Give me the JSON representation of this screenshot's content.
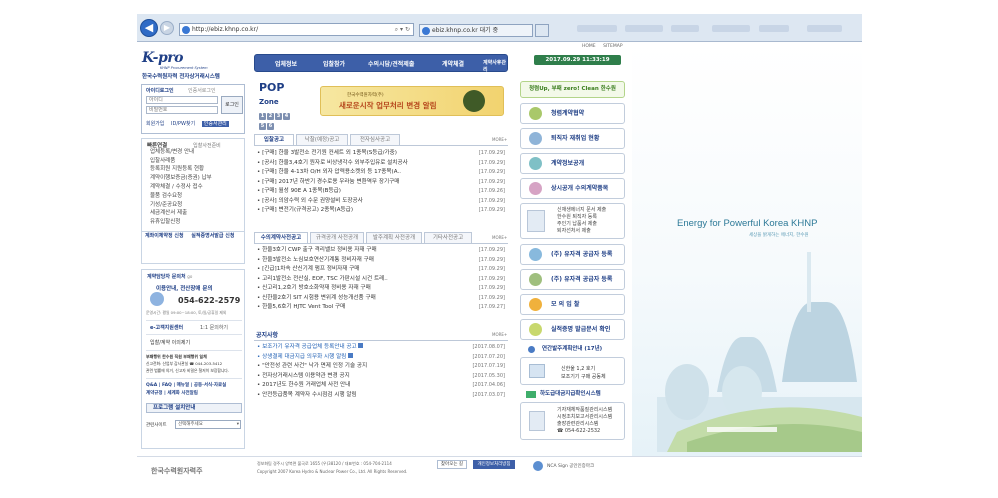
{
  "browser": {
    "url": "http://ebiz.khnp.co.kr/",
    "tabs": [
      "ebiz.khnp.co.kr 대기 중",
      ""
    ]
  },
  "header": {
    "top_links": [
      "HOME",
      "SITEMAP"
    ],
    "logo_text": "K-pro",
    "logo_sub": "KHNP Procurement System",
    "logo_name": "한국수력원자력 전자상거래시스템",
    "nav": [
      "업체정보",
      "입찰참가",
      "수의시담/견적제출",
      "계약체결",
      "계약사후관리"
    ],
    "datetime": "2017.09.29   11:33:19"
  },
  "login": {
    "tabs": [
      "아이디로그인",
      "인증서로그인"
    ],
    "id_placeholder": "아이디",
    "pw_placeholder": "비밀번호",
    "login_button": "로그인",
    "links": [
      "회원가입",
      "ID/PW찾기",
      "인증서관리"
    ]
  },
  "quick": {
    "title": "빠른연결",
    "sub": "입찰사전준비",
    "items": [
      "업체등록/변경 안내",
      "입찰사례품",
      "등록회원 지원등록 현황",
      "계약이행보증금(증권) 납부",
      "계약체결 / 수정사 접수",
      "물품 검수요청",
      "기성/준공요청",
      "세금계산서 제출",
      "유휴입찰신청"
    ],
    "banner1": "계좌이체약정 신청",
    "banner2": "실적증명서발급 신청"
  },
  "contact": {
    "title": "계약담당자 문의처",
    "title_more": "go",
    "line1": "이용안내, 전산장애 문의",
    "phone": "054-622-2579",
    "hours": "운영시간: 평일 09:00~18:00, 토/일/공휴일 제외",
    "center": "e-고객지원센터",
    "center_sub": "1:1 문의하기",
    "consult": "입찰/계약 이의제기",
    "report_title": "부패행위 한수원 직원 부패행위 일체",
    "report_lines": [
      "신고전화: 산업부 감사관실 ☎ 044-203-5412",
      "관련 법률에 의거, 신고자 비밀은 철저히 보장합니다."
    ],
    "links": [
      "Q&A",
      "FAQ",
      "매뉴얼",
      "공동·서식·자료실",
      "계약규정",
      "세계화 사전알림"
    ],
    "program": "프로그램 설치안내",
    "select_label": "관련사이트",
    "select_value": "선택해주세요"
  },
  "pop": {
    "title": "POP",
    "title_small": "Zone",
    "nums": [
      "1",
      "2",
      "3",
      "4",
      "5",
      "6"
    ],
    "banner_small": "한국수력원자력(주)",
    "banner_main": "새로운시작 업무처리 변경 알림"
  },
  "bid_notice": {
    "tabs": [
      "입찰공고",
      "낙찰(예정)공고",
      "전자심사공고"
    ],
    "more": "MORE+",
    "rows": [
      {
        "t": "[구매] 한울 3발전소 전기원 컨세트 외 1종목(S등급/가중)",
        "d": "[17.09.29]"
      },
      {
        "t": "[공사] 한울3,4호기 원자로 비상냉각수 외부주입유로 설치공사",
        "d": "[17.09.29]"
      },
      {
        "t": "[구매] 한울 4-13차 O/H 외자 압력용소켓외 등 17종목(A..",
        "d": "[17.09.29]"
      },
      {
        "t": "[구매] 2017년 하반기 경수로용 우라늄 변환역무 장기구매",
        "d": "[17.09.29]"
      },
      {
        "t": "[구매] 월성 90E A 1종목(B등급)",
        "d": "[17.09.26]"
      },
      {
        "t": "[공사] 의암수력 외 수문 권양설비 도장공사",
        "d": "[17.09.29]"
      },
      {
        "t": "[구매] 변전기(규격공고) 2종목(A등급)",
        "d": "[17.09.29]"
      }
    ]
  },
  "private": {
    "tabs": [
      "수의계약사전공고",
      "규격공개 사전공개",
      "발주계획 사전공개",
      "기타사전공고"
    ],
    "more": "MORE+",
    "rows": [
      {
        "t": "한울3호기 CWP 출구 격리밸브 정비용 자재 구매",
        "d": "[17.09.29]"
      },
      {
        "t": "한울3발전소 노심보호연산기계통 정비자재 구매",
        "d": "[17.09.29]"
      },
      {
        "t": "[긴급]1차속 산신기계 펌프 정비자재 구매",
        "d": "[17.09.29]"
      },
      {
        "t": "고리1발전소 전산실, EOF, TSC 가판시설 시건 트레..",
        "d": "[17.09.29]"
      },
      {
        "t": "신고리1,2호기 방호소화약재 정비용 자재 구매",
        "d": "[17.09.29]"
      },
      {
        "t": "신한울2호기 SIT 시험용 변위계 성능개선품 구매",
        "d": "[17.09.29]"
      },
      {
        "t": "한울5,6호기 HJTC Vent Tool 구매",
        "d": "[17.09.27]"
      }
    ]
  },
  "notice": {
    "title": "공지사항",
    "more": "MORE+",
    "rows": [
      {
        "t": "보조가기 유자격 공급업체 등록안내 공고",
        "d": "[2017.08.07]",
        "hl": true
      },
      {
        "t": "상생결제 대금지급 의무화 시행 알림",
        "d": "[2017.07.20]",
        "hl": true
      },
      {
        "t": "\"안전성 관련 사건\" 낙가 면제 인정 기술 공지",
        "d": "[2017.07.19]",
        "hl": false
      },
      {
        "t": "전자상거래시스템 이용약관 변경 공지",
        "d": "[2017.05.30]",
        "hl": false
      },
      {
        "t": "2017년도 한수원 거래업체 사전 안내",
        "d": "[2017.04.06]",
        "hl": false
      },
      {
        "t": "안전등급품목 계약자 수시점검 시행 알림",
        "d": "[2017.03.07]",
        "hl": false
      }
    ]
  },
  "right": {
    "clean_banner": "청렴Up, 부패 zero! Clean 한수원",
    "buttons": [
      "청렴계약협약",
      "퇴직자 재취업 현황",
      "계약정보공개",
      "상시공개 수의계약품목"
    ],
    "list1": [
      "신재생에너지 문서 제출",
      "한수원 퇴직자 등록",
      "주인기 납품서 제출",
      "퇴자선처서 제출"
    ],
    "buttons2": [
      "(주) 유자격 공급자 등록",
      "(주) 유자격 공급자 등록",
      "모 의 입 찰",
      "실적증명 발급문서 확인",
      "연간발주계획안내 (17년)"
    ],
    "report_line1": "신한울 1,2 호기",
    "report_line2": "보조기기 구매 공동체",
    "small_title": "하도급대금지급확인시스템",
    "small_list": [
      "기자재체작품질관리시스템",
      "시정조치보고서관리시스템",
      "출장관련관리시스템",
      "☎ 054-622-2532"
    ]
  },
  "footer": {
    "logo": "한국수력원자력주",
    "lines": [
      "정보화팀 경주시 양북면 불국로 1655 (우)38120 / 대표번호 : 054-704-2114",
      "Copyright 2007 Korea Hydro & Nuclear Power Co., Ltd. All Rights Reserved."
    ],
    "btn1": "찾아오는 길",
    "btn2": "개인정보처리방침",
    "nca": "NCA Sign 공인인증마크"
  },
  "slogan": {
    "main": "Energy for Powerful Korea KHNP",
    "sub": "세상을 밝게하는 에너지, 한수원"
  }
}
